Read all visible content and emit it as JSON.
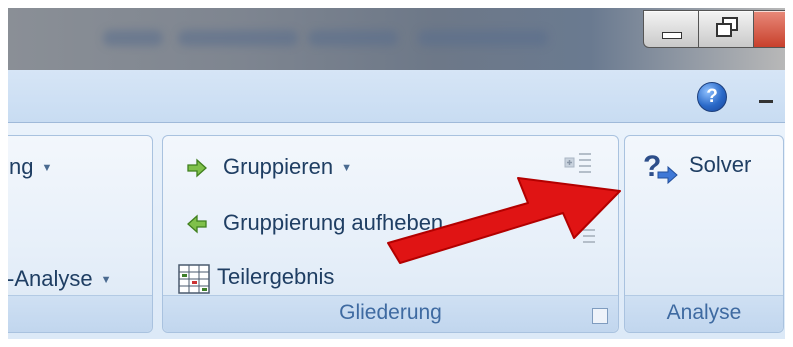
{
  "window": {
    "controls": {
      "minimize_icon": "minimize-icon",
      "restore_icon": "restore-icon",
      "close_icon": "close-icon"
    }
  },
  "tabstrip": {
    "help_glyph": "?",
    "help_icon": "help-icon",
    "collapse_icon": "minimize-ribbon-icon"
  },
  "left_group": {
    "item_top_label": "ng",
    "item_bottom_label": "-Analyse"
  },
  "gliederung": {
    "label": "Gliederung",
    "items": [
      {
        "label": "Gruppieren",
        "icon": "group-arrow-right-icon"
      },
      {
        "label": "Gruppierung aufheben",
        "icon": "ungroup-arrow-left-icon"
      },
      {
        "label": "Teilergebnis",
        "icon": "subtotal-icon"
      }
    ]
  },
  "analyse": {
    "label": "Analyse",
    "solver_label": "Solver",
    "solver_icon": "solver-icon"
  },
  "annotation": {
    "color": "#e01414",
    "icon": "red-pointer-arrow"
  }
}
